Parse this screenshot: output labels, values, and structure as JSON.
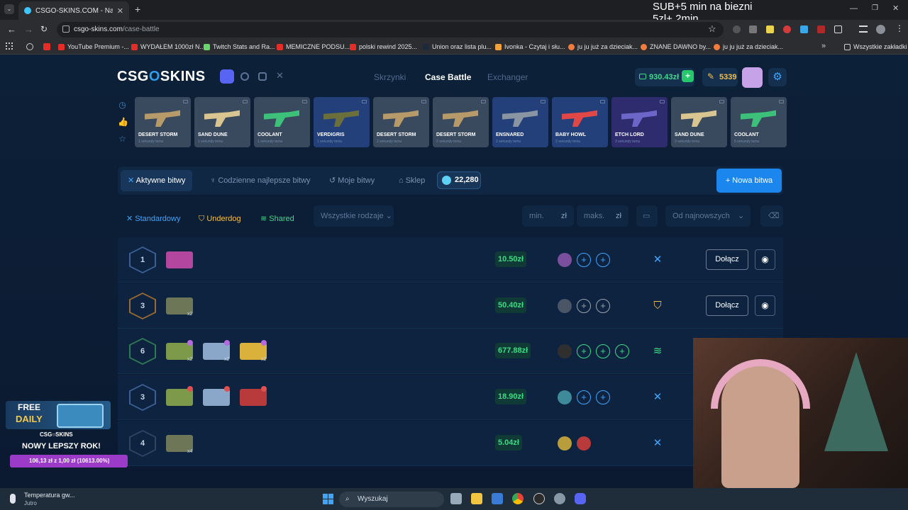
{
  "browser": {
    "tab_title": "CSGO-SKINS.COM - Najlepsze",
    "url_host": "csgo-skins.com",
    "url_path": "/case-battle",
    "bookmarks": [
      "YouTube Premium -...",
      "WYDAŁEM 1000zł N...",
      "Twitch Stats and Ra...",
      "MEMICZNE PODSU...",
      "polski rewind 2025...",
      "Union oraz lista plu...",
      "Ivonka - Czytaj i słu...",
      "ju ju już za dzieciak...",
      "ZNANE DAWNO by...",
      "ju ju już za dzieciak..."
    ],
    "all_bookmarks": "Wszystkie zakładki"
  },
  "stream_overlay": {
    "line1": "SUB+5 min na biezni",
    "line2": "5zl+ 2min"
  },
  "site": {
    "logo_a": "CSG",
    "logo_b": "O",
    "logo_c": "SKINS",
    "nav": [
      "Skrzynki",
      "Case Battle",
      "Exchanger"
    ],
    "balance": "930.43zł",
    "coins": "5339",
    "live_drops": [
      {
        "name": "DESERT STORM",
        "time": "1 sekundy temu",
        "color": "#3a4a5e"
      },
      {
        "name": "SAND DUNE",
        "time": "1 sekundy temu",
        "color": "#3a4a5e"
      },
      {
        "name": "COOLANT",
        "time": "1 sekundy temu",
        "color": "#3a4a5e"
      },
      {
        "name": "VERDIGRIS",
        "time": "1 sekundy temu",
        "color": "#23407a"
      },
      {
        "name": "DESERT STORM",
        "time": "2 sekundy temu",
        "color": "#3a4a5e"
      },
      {
        "name": "DESERT STORM",
        "time": "2 sekundy temu",
        "color": "#3a4a5e"
      },
      {
        "name": "ENSNARED",
        "time": "2 sekundy temu",
        "color": "#23407a"
      },
      {
        "name": "BABY HOWL",
        "time": "2 sekundy temu",
        "color": "#23407a"
      },
      {
        "name": "ETCH LORD",
        "time": "3 sekundy temu",
        "color": "#2e2c6e"
      },
      {
        "name": "SAND DUNE",
        "time": "3 sekundy temu",
        "color": "#3a4a5e"
      },
      {
        "name": "COOLANT",
        "time": "5 sekundy temu",
        "color": "#3a4a5e"
      }
    ],
    "tabs": [
      "Aktywne bitwy",
      "Codzienne najlepsze bitwy",
      "Moje bitwy",
      "Sklep"
    ],
    "gems": "22,280",
    "new_battle": "+ Nowa bitwa",
    "filters": {
      "modes": [
        "Standardowy",
        "Underdog",
        "Shared"
      ],
      "type_select": "Wszystkie rodzaje",
      "min_placeholder": "min.",
      "max_placeholder": "maks.",
      "currency": "zł",
      "sort": "Od najnowszych"
    },
    "battles": [
      {
        "rounds": "1",
        "price": "10.50zł",
        "mode": "standard",
        "join": "Dołącz",
        "hex": "#3d5f93"
      },
      {
        "rounds": "3",
        "price": "50.40zł",
        "mode": "underdog",
        "join": "Dołącz",
        "hex": "#9b6a2f"
      },
      {
        "rounds": "6",
        "price": "677.88zł",
        "mode": "shared",
        "join": "",
        "hex": "#2f7a54"
      },
      {
        "rounds": "3",
        "price": "18.90zł",
        "mode": "standard",
        "join": "",
        "hex": "#3d5f93"
      },
      {
        "rounds": "4",
        "price": "5.04zł",
        "mode": "standard",
        "join": "",
        "hex": "#2e4566"
      }
    ],
    "case_multipliers": [
      "x3",
      "x2",
      "x2",
      "x2",
      "x4"
    ]
  },
  "promo": {
    "free": "FREE",
    "daily": "DAILY",
    "brand": "CSG○SKINS",
    "headline": "NOWY LEPSZY ROK!",
    "progress_text": "106,13 zł z 1,00 zł (10613.00%)"
  },
  "taskbar": {
    "weather_title": "Temperatura gw...",
    "weather_sub": "Jutro",
    "search": "Wyszukaj"
  },
  "colors": {
    "accent": "#1a86ee",
    "price_green": "#3ddc84",
    "standard": "#3fa5ff",
    "underdog": "#f0c04e",
    "shared": "#3ddc84"
  }
}
